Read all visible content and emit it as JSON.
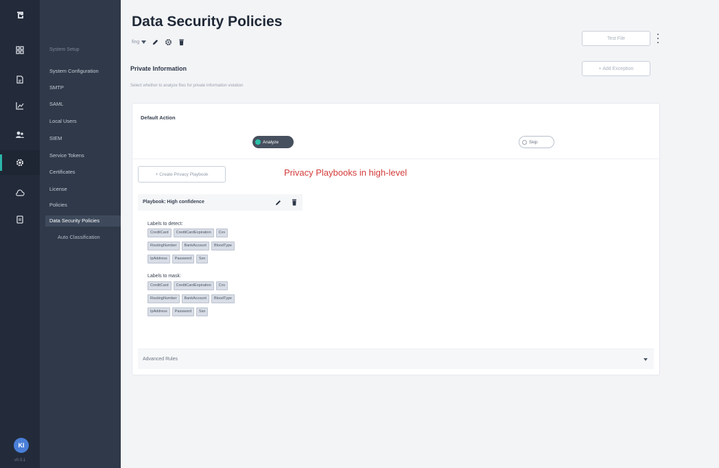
{
  "rail": {
    "items": [
      {
        "id": "logo",
        "icon": "app-logo-icon"
      },
      {
        "id": "dashboard",
        "icon": "grid-icon"
      },
      {
        "id": "files",
        "icon": "file-icon"
      },
      {
        "id": "reports",
        "icon": "chart-icon"
      },
      {
        "id": "users",
        "icon": "users-icon"
      },
      {
        "id": "settings",
        "icon": "gear-icon",
        "active": true
      },
      {
        "id": "cloud",
        "icon": "cloud-icon"
      },
      {
        "id": "docs",
        "icon": "document-icon"
      }
    ],
    "avatar_initials": "KI",
    "version_text": "v0.0.1"
  },
  "subnav": {
    "header": "System Setup",
    "items": [
      "System Configuration",
      "SMTP",
      "SAML",
      "Local Users",
      "SIEM",
      "Service Tokens",
      "Certificates",
      "License",
      "Policies",
      "Data Security Policies",
      "Auto Classification"
    ]
  },
  "page": {
    "title": "Data Security Policies",
    "version_selector": "fing",
    "test_file_button": "Test File",
    "add_exception_button": "+ Add Exception",
    "section_title": "Private Information",
    "section_subtitle": "Select whether to analyze files for private information violation"
  },
  "default_action": {
    "label": "Default Action",
    "options": [
      "Analyze",
      "Skip"
    ],
    "selected": "Analyze"
  },
  "playbooks": {
    "create_button": "+ Create Privacy Playbook",
    "annotation": "Privacy Playbooks in high-level",
    "name": "Playbook: High confidence",
    "detect_title": "Labels to detect:",
    "detect_rows": [
      [
        "CreditCard",
        "CreditCardExpiration",
        "Cvv"
      ],
      [
        "RoutingNumber",
        "BankAccount",
        "BloodType"
      ],
      [
        "IpAddress",
        "Password",
        "Ssn"
      ]
    ],
    "mask_title": "Labels to mask:",
    "mask_rows": [
      [
        "CreditCard",
        "CreditCardExpiration",
        "Cvv"
      ],
      [
        "RoutingNumber",
        "BankAccount",
        "BloodType"
      ],
      [
        "IpAddress",
        "Password",
        "Ssn"
      ]
    ]
  },
  "advanced": {
    "label": "Advanced Rules"
  },
  "colors": {
    "rail_bg": "#232b3a",
    "subnav_bg": "#2f3949",
    "accent": "#2bb5a8",
    "annotation": "#d43a3a"
  }
}
